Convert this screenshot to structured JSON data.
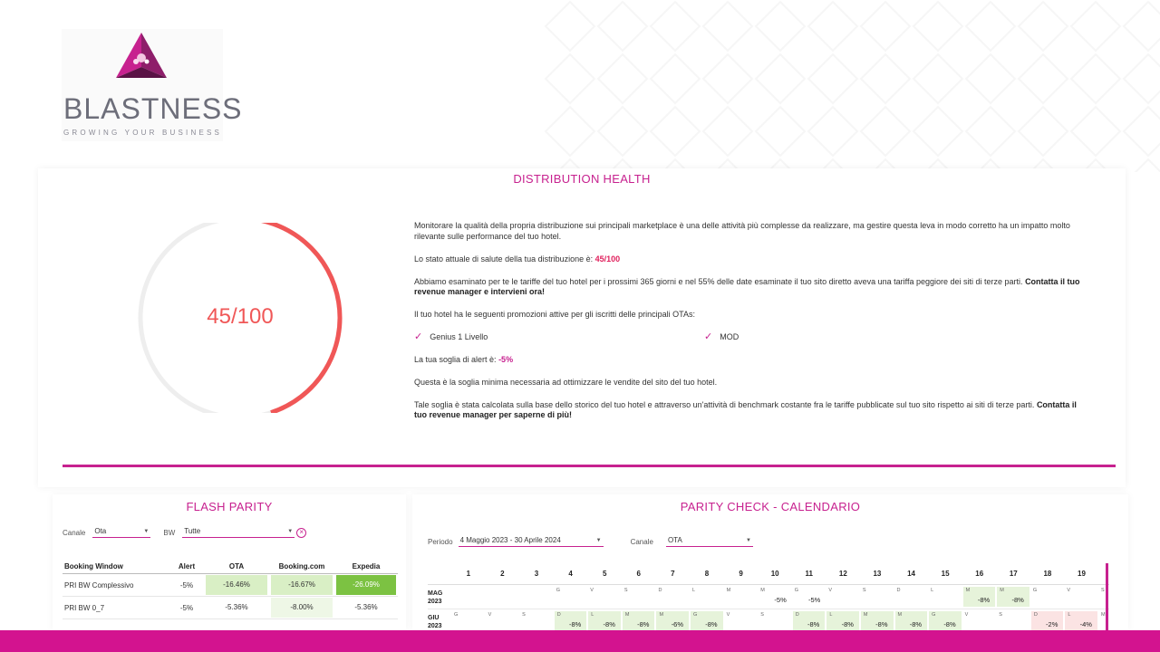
{
  "brand": {
    "name": "BLASTNESS",
    "tagline": "GROWING YOUR BUSINESS",
    "accent": "#c7218f",
    "bar_color": "#d3138f"
  },
  "health": {
    "title": "DISTRIBUTION HEALTH",
    "score_label": "45/100",
    "score": 45,
    "score_max": 100,
    "gauge_color": "#f05757",
    "intro": "Monitorare la qualità della propria distribuzione sui principali marketplace è una delle attività più complesse da realizzare, ma gestire questa leva in modo corretto ha un impatto molto rilevante sulle performance del tuo hotel.",
    "status_prefix": "Lo stato attuale di salute della tua distribuzione è: ",
    "status_value": "45/100",
    "exam_text": "Abbiamo esaminato per te le tariffe del tuo hotel per i prossimi 365 giorni e nel 55% delle date esaminate il tuo sito diretto aveva una tariffa peggiore dei siti di terze parti. ",
    "exam_cta": "Contatta il tuo revenue manager e intervieni ora!",
    "promos_intro": "Il tuo hotel ha le seguenti promozioni attive per gli iscritti delle principali OTAs:",
    "promos": [
      "Genius 1 Livello",
      "MOD"
    ],
    "alert_prefix": "La tua soglia di alert è: ",
    "alert_value": "-5%",
    "threshold_text": "Questa è la soglia minima necessaria ad ottimizzare le vendite del sito del tuo hotel.",
    "calc_text": "Tale soglia è stata calcolata sulla base dello storico del tuo hotel e attraverso un'attività di benchmark costante fra le tariffe pubblicate sul tuo sito rispetto ai siti di terze parti. ",
    "calc_cta": "Contatta il tuo revenue manager per saperne di più!"
  },
  "flash": {
    "title": "FLASH PARITY",
    "canale_label": "Canale",
    "canale_value": "Ota",
    "bw_label": "BW",
    "bw_value": "Tutte",
    "columns": [
      "Booking Window",
      "Alert",
      "OTA",
      "Booking.com",
      "Expedia"
    ],
    "rows": [
      {
        "name": "PRI BW Complessivo",
        "alert": "-5%",
        "ota": "-16.46%",
        "booking": "-16.67%",
        "expedia": "-26.09%"
      },
      {
        "name": "PRI BW 0_7",
        "alert": "-5%",
        "ota": "-5.36%",
        "booking": "-8.00%",
        "expedia": "-5.36%"
      }
    ]
  },
  "calendar": {
    "title": "PARITY CHECK - CALENDARIO",
    "periodo_label": "Periodo",
    "periodo_value": "4 Maggio 2023 - 30 Aprile 2024",
    "canale_label": "Canale",
    "canale_value": "OTA",
    "days": [
      "1",
      "2",
      "3",
      "4",
      "5",
      "6",
      "7",
      "8",
      "9",
      "10",
      "11",
      "12",
      "13",
      "14",
      "15",
      "16",
      "17",
      "18",
      "19"
    ],
    "rows": [
      {
        "month": "MAG",
        "year": "2023",
        "cells": [
          {
            "w": "",
            "v": "",
            "s": ""
          },
          {
            "w": "",
            "v": "",
            "s": ""
          },
          {
            "w": "",
            "v": "",
            "s": ""
          },
          {
            "w": "G",
            "v": "",
            "s": ""
          },
          {
            "w": "V",
            "v": "",
            "s": ""
          },
          {
            "w": "S",
            "v": "",
            "s": ""
          },
          {
            "w": "D",
            "v": "",
            "s": ""
          },
          {
            "w": "L",
            "v": "",
            "s": ""
          },
          {
            "w": "M",
            "v": "",
            "s": ""
          },
          {
            "w": "M",
            "v": "-5%",
            "s": ""
          },
          {
            "w": "G",
            "v": "-5%",
            "s": ""
          },
          {
            "w": "V",
            "v": "",
            "s": ""
          },
          {
            "w": "S",
            "v": "",
            "s": ""
          },
          {
            "w": "D",
            "v": "",
            "s": ""
          },
          {
            "w": "L",
            "v": "",
            "s": ""
          },
          {
            "w": "M",
            "v": "-8%",
            "s": "gr"
          },
          {
            "w": "M",
            "v": "-8%",
            "s": "gr"
          },
          {
            "w": "G",
            "v": "",
            "s": ""
          },
          {
            "w": "V",
            "v": "",
            "s": ""
          }
        ],
        "extra": "S"
      },
      {
        "month": "GIU",
        "year": "2023",
        "cells": [
          {
            "w": "G",
            "v": "",
            "s": ""
          },
          {
            "w": "V",
            "v": "",
            "s": ""
          },
          {
            "w": "S",
            "v": "",
            "s": ""
          },
          {
            "w": "D",
            "v": "-8%",
            "s": "gr"
          },
          {
            "w": "L",
            "v": "-8%",
            "s": "gr"
          },
          {
            "w": "M",
            "v": "-8%",
            "s": "gr"
          },
          {
            "w": "M",
            "v": "-6%",
            "s": "gr"
          },
          {
            "w": "G",
            "v": "-8%",
            "s": "gr"
          },
          {
            "w": "V",
            "v": "",
            "s": ""
          },
          {
            "w": "S",
            "v": "",
            "s": ""
          },
          {
            "w": "D",
            "v": "-8%",
            "s": "gr"
          },
          {
            "w": "L",
            "v": "-8%",
            "s": "gr"
          },
          {
            "w": "M",
            "v": "-8%",
            "s": "gr"
          },
          {
            "w": "M",
            "v": "-8%",
            "s": "gr"
          },
          {
            "w": "G",
            "v": "-8%",
            "s": "gr"
          },
          {
            "w": "V",
            "v": "",
            "s": ""
          },
          {
            "w": "S",
            "v": "",
            "s": ""
          },
          {
            "w": "D",
            "v": "-2%",
            "s": "rd"
          },
          {
            "w": "L",
            "v": "-4%",
            "s": "rd"
          }
        ],
        "extra": "M"
      }
    ]
  }
}
